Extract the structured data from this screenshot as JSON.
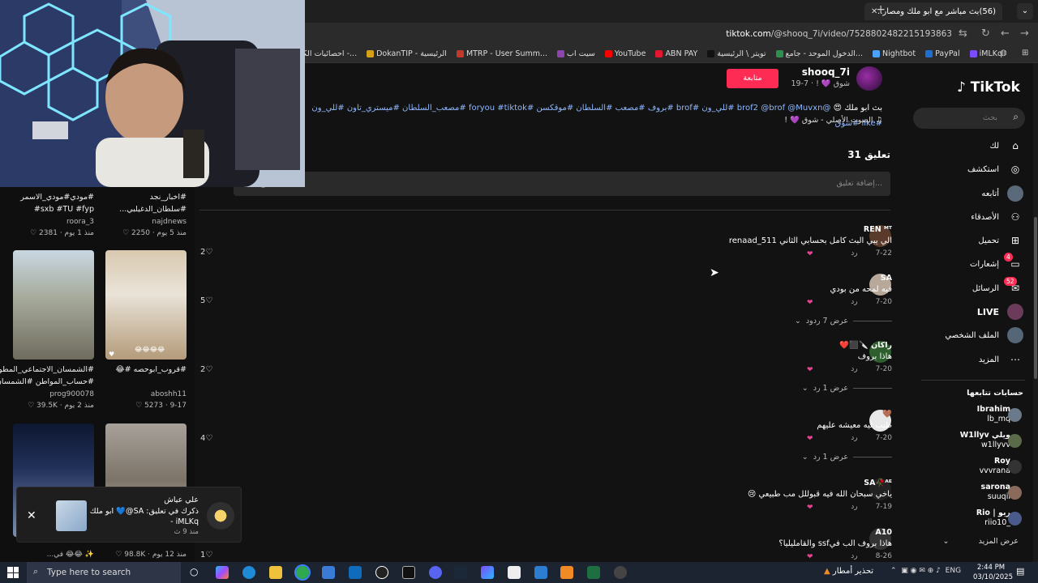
{
  "browser": {
    "tab_title": "(56)بث مباشر مع ابو ملك ومصار...",
    "url_domain": "tiktok.com",
    "url_path": "/@shooq_7i/video/7528802482215193863",
    "bookmarks": [
      {
        "label": "iMLKq",
        "color": "#7b4cff"
      },
      {
        "label": "PayPal",
        "color": "#1f6fd1"
      },
      {
        "label": "Nightbot",
        "color": "#4aa3ff"
      },
      {
        "label": "الدخول الموحد - جامع...",
        "color": "#2f8f4e"
      },
      {
        "label": "تويتر \\ الرئيسية",
        "color": "#111111"
      },
      {
        "label": "ABN PAY",
        "color": "#e3172f"
      },
      {
        "label": "YouTube",
        "color": "#ff0000"
      },
      {
        "label": "سيت اب",
        "color": "#8e44ad"
      },
      {
        "label": "MTRP - User Summ...",
        "color": "#c0392b"
      },
      {
        "label": "DokanTIP - الرئيسية",
        "color": "#d4a017"
      },
      {
        "label": "احصائيات الكوبون -...",
        "color": "#888888"
      },
      {
        "label": "احصائيات",
        "color": "#e91e63"
      }
    ]
  },
  "left_grid": {
    "row1": [
      {
        "caption1": "#مودي#مودي_الاسمر",
        "caption2": "sxb #TU #fyp#",
        "user": "roora_3",
        "likes": "2381",
        "age": "منذ 1 يوم"
      },
      {
        "caption1": "#اخبار_نجد",
        "caption2": "#سلطان_الدغيلبي...",
        "user": "najdnews",
        "likes": "2250",
        "age": "منذ 5 يوم"
      }
    ],
    "row2": [
      {
        "caption1": "#الشمسان_الاجتماعي_المطور",
        "caption2": "#حساب_المواطن #الشمسان...",
        "user": "prog900078",
        "likes": "39.5K",
        "age": "منذ 2 يوم"
      },
      {
        "caption1": "#قروب_ابوحصه #😂",
        "caption2": "",
        "user": "aboshh11",
        "likes": "5273",
        "age": "9-17"
      }
    ],
    "row3_meta": {
      "likes": "98.8K",
      "age": "منذ 12 يوم"
    },
    "row3_caption": "✨ 😂😂 في...",
    "side_likes": [
      "2",
      "5",
      "2",
      "4",
      "1"
    ],
    "thumb_overlay": "😂😂😂😂"
  },
  "post": {
    "follow_label": "متابعة",
    "author_name": "shooq_7i",
    "author_sub": "شوق 💜 ! · 7-19",
    "caption_plain": "بث ابو ملك 😍",
    "caption_tags": "@brof2 @brof @Muvxn #للي_ون #brof #بروف #مصعب #السلطان #موقكسن #foryou #tiktok #مصعب_السلطان #ميستري_تاون #للي_ون #like #شوق",
    "music": "♫ الصوت الأصلي - شوق 💜 !",
    "comment_count": "31 تعليق",
    "comment_placeholder": "إضافة تعليق..."
  },
  "comments": [
    {
      "user": "REN ᴹᵀ",
      "text": "الي يبي البث كامل بحسابي الثاني renaad_511",
      "date": "7-22",
      "reply": "رد",
      "avatar": "#5a3a2a"
    },
    {
      "user": "SA",
      "text": "فيه لمحه من بودي",
      "date": "7-20",
      "reply": "رد",
      "avatar": "#b8a89a",
      "replies": "عرض 7 ردود"
    },
    {
      "user": "راكان 🔪⬛️❤️",
      "text": "هاذا بروف",
      "date": "7-20",
      "reply": "رد",
      "avatar": "#2e5e2e",
      "replies": "عرض 1 رد"
    },
    {
      "user": "🤎",
      "text": "طيب ليه معيشه عليهم",
      "date": "7-20",
      "reply": "رد",
      "avatar": "#e8e8e8",
      "replies": "عرض 1 رد"
    },
    {
      "user": "SA🥀ᴬᴱ",
      "text": "ياخي سبحان الله فيه قبوللل مب طبيعي 😢",
      "date": "7-19",
      "reply": "رد",
      "avatar": "#222222"
    },
    {
      "user": "A10",
      "text": "هاذا بروف الب فيssf والقامليليا؟",
      "date": "8-26",
      "reply": "رد",
      "avatar": "#333333"
    }
  ],
  "sidebar": {
    "logo": "TikTok",
    "search_placeholder": "بحث",
    "nav": [
      {
        "label": "لك",
        "icon": "⌂",
        "name": "for-you"
      },
      {
        "label": "استكشف",
        "icon": "◎",
        "name": "explore"
      },
      {
        "label": "أتابعه",
        "icon": "●",
        "name": "following"
      },
      {
        "label": "الأصدقاء",
        "icon": "⚇",
        "name": "friends"
      },
      {
        "label": "تحميل",
        "icon": "⊞",
        "name": "upload"
      },
      {
        "label": "إشعارات",
        "icon": "▭",
        "name": "notifications",
        "badge": "4"
      },
      {
        "label": "الرسائل",
        "icon": "✉",
        "name": "messages",
        "badge": "52"
      },
      {
        "label": "LIVE",
        "icon": "●",
        "name": "live"
      },
      {
        "label": "الملف الشخصي",
        "icon": "●",
        "name": "profile"
      },
      {
        "label": "المزيد",
        "icon": "⋯",
        "name": "more"
      }
    ],
    "follows_title": "حسابات تتابعها",
    "accounts": [
      {
        "name": "Ibrahim",
        "handle": "lb_mq"
      },
      {
        "name": "W1llyv ويلي",
        "handle": "w1llyvv"
      },
      {
        "name": "Roy",
        "handle": "vvvrana"
      },
      {
        "name": "sarona",
        "handle": "suuqii"
      },
      {
        "name": "Rio | ريو",
        "handle": "riio10_"
      }
    ],
    "see_more": "عرض المزيد"
  },
  "notification": {
    "name": "علي عياش",
    "text": "ذكرك في تعليق: SA@💙 ابو ملك",
    "handle": "iMLKq -",
    "age": "منذ 9 ث"
  },
  "taskbar": {
    "search_placeholder": "Type here to search",
    "weather": "تحذير أمطار",
    "lang": "ENG",
    "time": "2:44 PM",
    "date": "03/10/2025"
  }
}
